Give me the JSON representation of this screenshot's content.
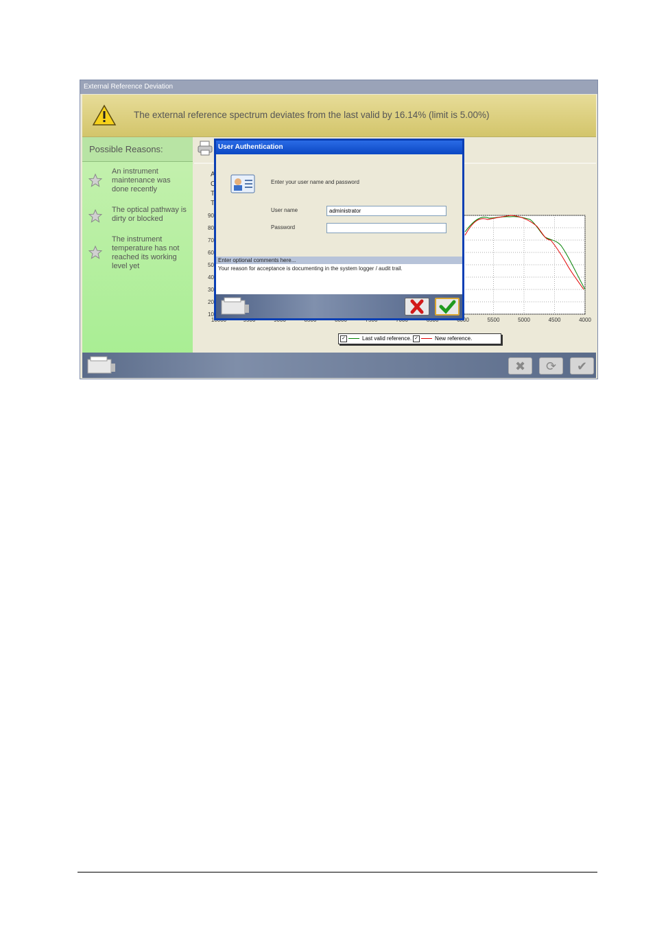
{
  "window": {
    "title": "External Reference Deviation",
    "warning_text": "The external reference spectrum deviates from the last valid by 16.14% (limit is 5.00%)"
  },
  "reasons": {
    "heading": "Possible Reasons:",
    "items": [
      {
        "text": "An instrument maintenance was done recently"
      },
      {
        "text": "The optical pathway is dirty or blocked"
      },
      {
        "text": "The instrument temperature has not reached its working level yet"
      }
    ]
  },
  "plot": {
    "partial_texts": [
      "A",
      "C",
      "T",
      "T"
    ],
    "y_tick_labels": [
      "90",
      "80",
      "70",
      "60",
      "50",
      "40",
      "30",
      "20",
      "10"
    ],
    "x_tick_labels": [
      "10000",
      "9500",
      "9000",
      "8500",
      "8000",
      "7500",
      "7000",
      "6500",
      "6000",
      "5500",
      "5000",
      "4500",
      "4000"
    ],
    "legend": [
      {
        "label": "Last valid reference.",
        "color": "#008000"
      },
      {
        "label": "New reference.",
        "color": "#e00000"
      }
    ]
  },
  "dialog": {
    "title": "User Authentication",
    "prompt": "Enter your user name and password",
    "username_label": "User name",
    "username_value": "administrator",
    "password_label": "Password",
    "password_value": "",
    "comments_header": "Enter optional comments here...",
    "comments_text": "Your reason for acceptance is documenting in the system logger / audit trail."
  },
  "icons": {
    "warning": "warning-icon",
    "star": "star-icon",
    "printer": "printer-icon",
    "cancel": "cancel-x-icon",
    "ok": "check-icon",
    "refresh": "refresh-icon"
  }
}
